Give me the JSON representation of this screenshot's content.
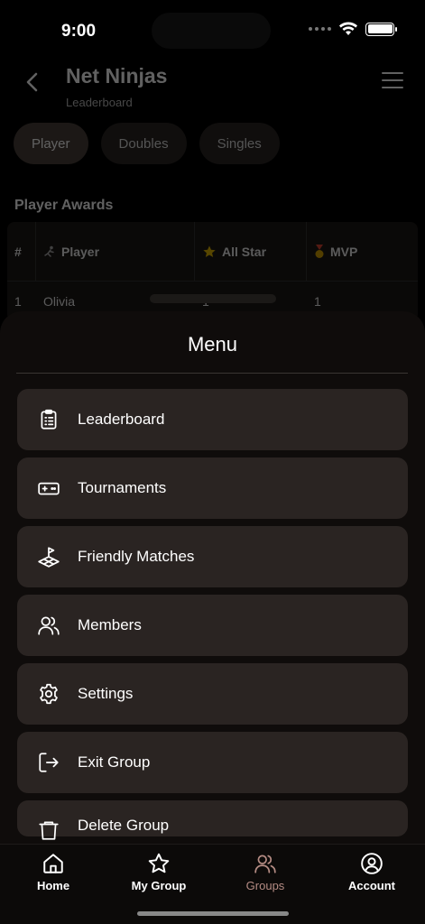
{
  "status": {
    "time": "9:00"
  },
  "header": {
    "title": "Net Ninjas",
    "subtitle": "Leaderboard"
  },
  "tabs": [
    {
      "label": "Player",
      "active": true
    },
    {
      "label": "Doubles",
      "active": false
    },
    {
      "label": "Singles",
      "active": false
    }
  ],
  "awards": {
    "title": "Player Awards",
    "columns": {
      "num": "#",
      "player": "Player",
      "allstar": "All Star",
      "mvp": "MVP"
    },
    "rows": [
      {
        "num": "1",
        "player": "Olivia",
        "allstar": "1",
        "mvp": "1"
      }
    ]
  },
  "menu": {
    "title": "Menu",
    "items": [
      {
        "label": "Leaderboard",
        "icon": "clipboard-icon"
      },
      {
        "label": "Tournaments",
        "icon": "gamepad-icon"
      },
      {
        "label": "Friendly Matches",
        "icon": "court-flag-icon"
      },
      {
        "label": "Members",
        "icon": "members-icon"
      },
      {
        "label": "Settings",
        "icon": "gear-icon"
      },
      {
        "label": "Exit Group",
        "icon": "exit-icon"
      },
      {
        "label": "Delete Group",
        "icon": "trash-icon"
      }
    ]
  },
  "tabbar": [
    {
      "label": "Home",
      "icon": "home-icon",
      "active": false
    },
    {
      "label": "My Group",
      "icon": "star-icon",
      "active": false
    },
    {
      "label": "Groups",
      "icon": "groups-icon",
      "active": true
    },
    {
      "label": "Account",
      "icon": "account-icon",
      "active": false
    }
  ],
  "colors": {
    "accent": "#b58c84",
    "sheet": "#0f0c0b",
    "menu_item": "#2a2422"
  }
}
